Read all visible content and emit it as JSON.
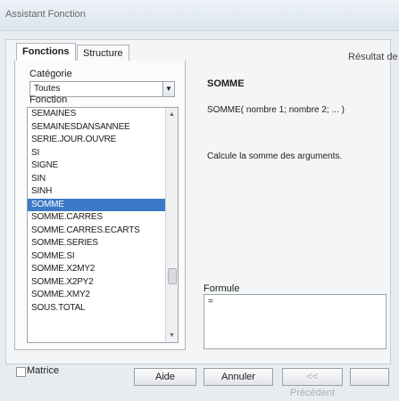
{
  "window": {
    "title": "Assistant Fonction"
  },
  "tabs": [
    {
      "label": "Fonctions"
    },
    {
      "label": "Structure"
    }
  ],
  "category": {
    "label": "Catégorie",
    "value": "Toutes"
  },
  "functions": {
    "label": "Fonction",
    "items": [
      "SEMAINES",
      "SEMAINESDANSANNEE",
      "SERIE.JOUR.OUVRE",
      "SI",
      "SIGNE",
      "SIN",
      "SINH",
      "SOMME",
      "SOMME.CARRES",
      "SOMME.CARRES.ECARTS",
      "SOMME.SERIES",
      "SOMME.SI",
      "SOMME.X2MY2",
      "SOMME.X2PY2",
      "SOMME.XMY2",
      "SOUS.TOTAL"
    ],
    "selected_index": 7
  },
  "result": {
    "label": "Résultat de"
  },
  "details": {
    "name": "SOMME",
    "syntax": "SOMME( nombre 1; nombre 2; ... )",
    "description": "Calcule la somme des arguments."
  },
  "formula": {
    "label": "Formule",
    "value": "="
  },
  "footer": {
    "array_label": "Matrice",
    "help_label": "Aide",
    "cancel_label": "Annuler",
    "prev_label": "<< Précédent"
  }
}
